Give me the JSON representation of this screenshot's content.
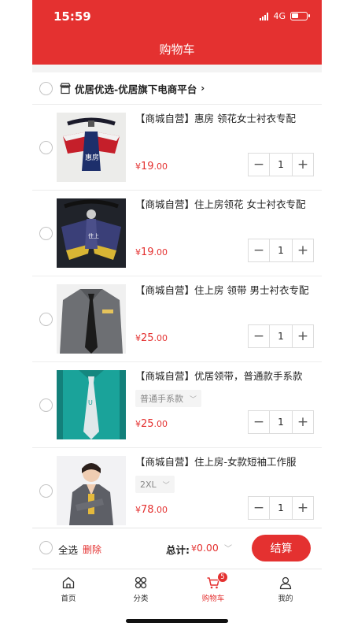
{
  "status": {
    "time": "15:59",
    "network": "4G"
  },
  "header": {
    "title": "购物车"
  },
  "shop": {
    "name": "优居优选-优居旗下电商平台",
    "chevron": "›"
  },
  "items": [
    {
      "name": "【商城自营】惠房 领花女士衬衣专配",
      "spec": "",
      "price_currency": "¥",
      "price_int": "19",
      "price_dec": ".00",
      "qty": "1"
    },
    {
      "name": "【商城自营】住上房领花 女士衬衣专配",
      "spec": "",
      "price_currency": "¥",
      "price_int": "19",
      "price_dec": ".00",
      "qty": "1"
    },
    {
      "name": "【商城自营】住上房 领带 男士衬衣专配",
      "spec": "",
      "price_currency": "¥",
      "price_int": "25",
      "price_dec": ".00",
      "qty": "1"
    },
    {
      "name": "【商城自营】优居领带，普通款手系款",
      "spec": "普通手系款",
      "price_currency": "¥",
      "price_int": "25",
      "price_dec": ".00",
      "qty": "1"
    },
    {
      "name": "【商城自营】住上房-女款短袖工作服",
      "spec": "2XL",
      "price_currency": "¥",
      "price_int": "78",
      "price_dec": ".00",
      "qty": "1"
    }
  ],
  "stepper": {
    "minus": "−",
    "plus": "+"
  },
  "checkout": {
    "select_all": "全选",
    "delete": "删除",
    "total_label": "总计:",
    "total_currency": "¥",
    "total_value": "0.00",
    "button": "结算"
  },
  "tabs": [
    {
      "label": "首页",
      "icon": "home-icon"
    },
    {
      "label": "分类",
      "icon": "category-icon"
    },
    {
      "label": "购物车",
      "icon": "cart-icon",
      "badge": "5",
      "active": true
    },
    {
      "label": "我的",
      "icon": "user-icon"
    }
  ],
  "colors": {
    "brand": "#e43130",
    "background": "#f3f3f3"
  }
}
